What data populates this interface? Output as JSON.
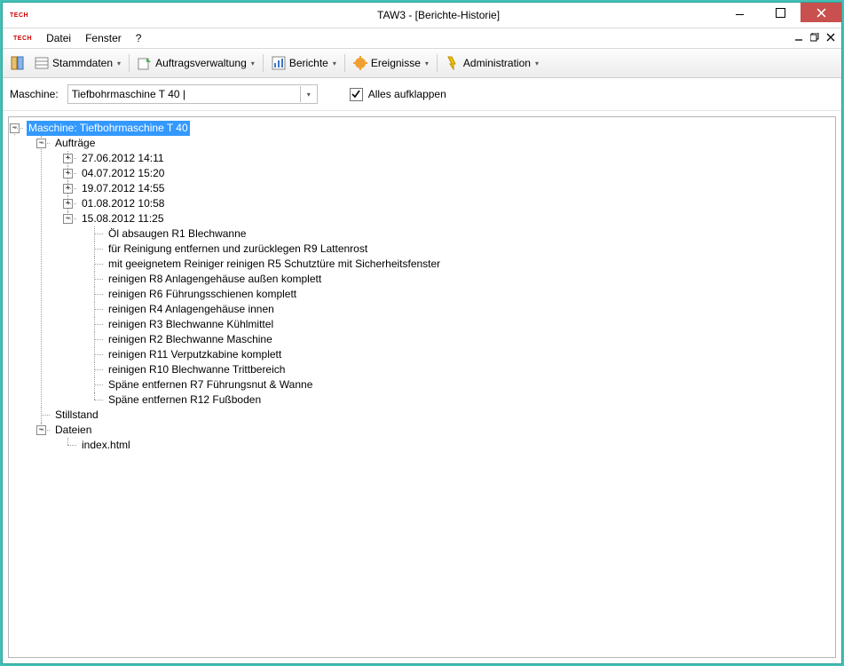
{
  "window": {
    "title": "TAW3 - [Berichte-Historie]",
    "logo": "TECH"
  },
  "menu": {
    "datei": "Datei",
    "fenster": "Fenster",
    "help": "?"
  },
  "toolbar": {
    "stammdaten": "Stammdaten",
    "auftragsverwaltung": "Auftragsverwaltung",
    "berichte": "Berichte",
    "ereignisse": "Ereignisse",
    "administration": "Administration"
  },
  "filter": {
    "label": "Maschine:",
    "value": "Tiefbohrmaschine T 40 |",
    "expand": "Alles aufklappen"
  },
  "tree": {
    "root": "Maschine: Tiefbohrmaschine T 40",
    "auftraege": "Aufträge",
    "d1": "27.06.2012 14:11",
    "d2": "04.07.2012 15:20",
    "d3": "19.07.2012 14:55",
    "d4": "01.08.2012 10:58",
    "d5": "15.08.2012 11:25",
    "t1": "Öl absaugen  R1 Blechwanne",
    "t2": "für Reinigung entfernen und zurücklegen  R9 Lattenrost",
    "t3": "mit geeignetem Reiniger reinigen  R5 Schutztüre mit Sicherheitsfenster",
    "t4": "reinigen  R8 Anlagengehäuse außen komplett",
    "t5": "reinigen  R6 Führungsschienen komplett",
    "t6": "reinigen  R4 Anlagengehäuse innen",
    "t7": "reinigen  R3 Blechwanne Kühlmittel",
    "t8": "reinigen  R2 Blechwanne Maschine",
    "t9": "reinigen  R11 Verputzkabine komplett",
    "t10": "reinigen  R10 Blechwanne Trittbereich",
    "t11": "Späne entfernen  R7 Führungsnut & Wanne",
    "t12": "Späne entfernen  R12 Fußboden",
    "stillstand": "Stillstand",
    "dateien": "Dateien",
    "file1": "index.html"
  }
}
